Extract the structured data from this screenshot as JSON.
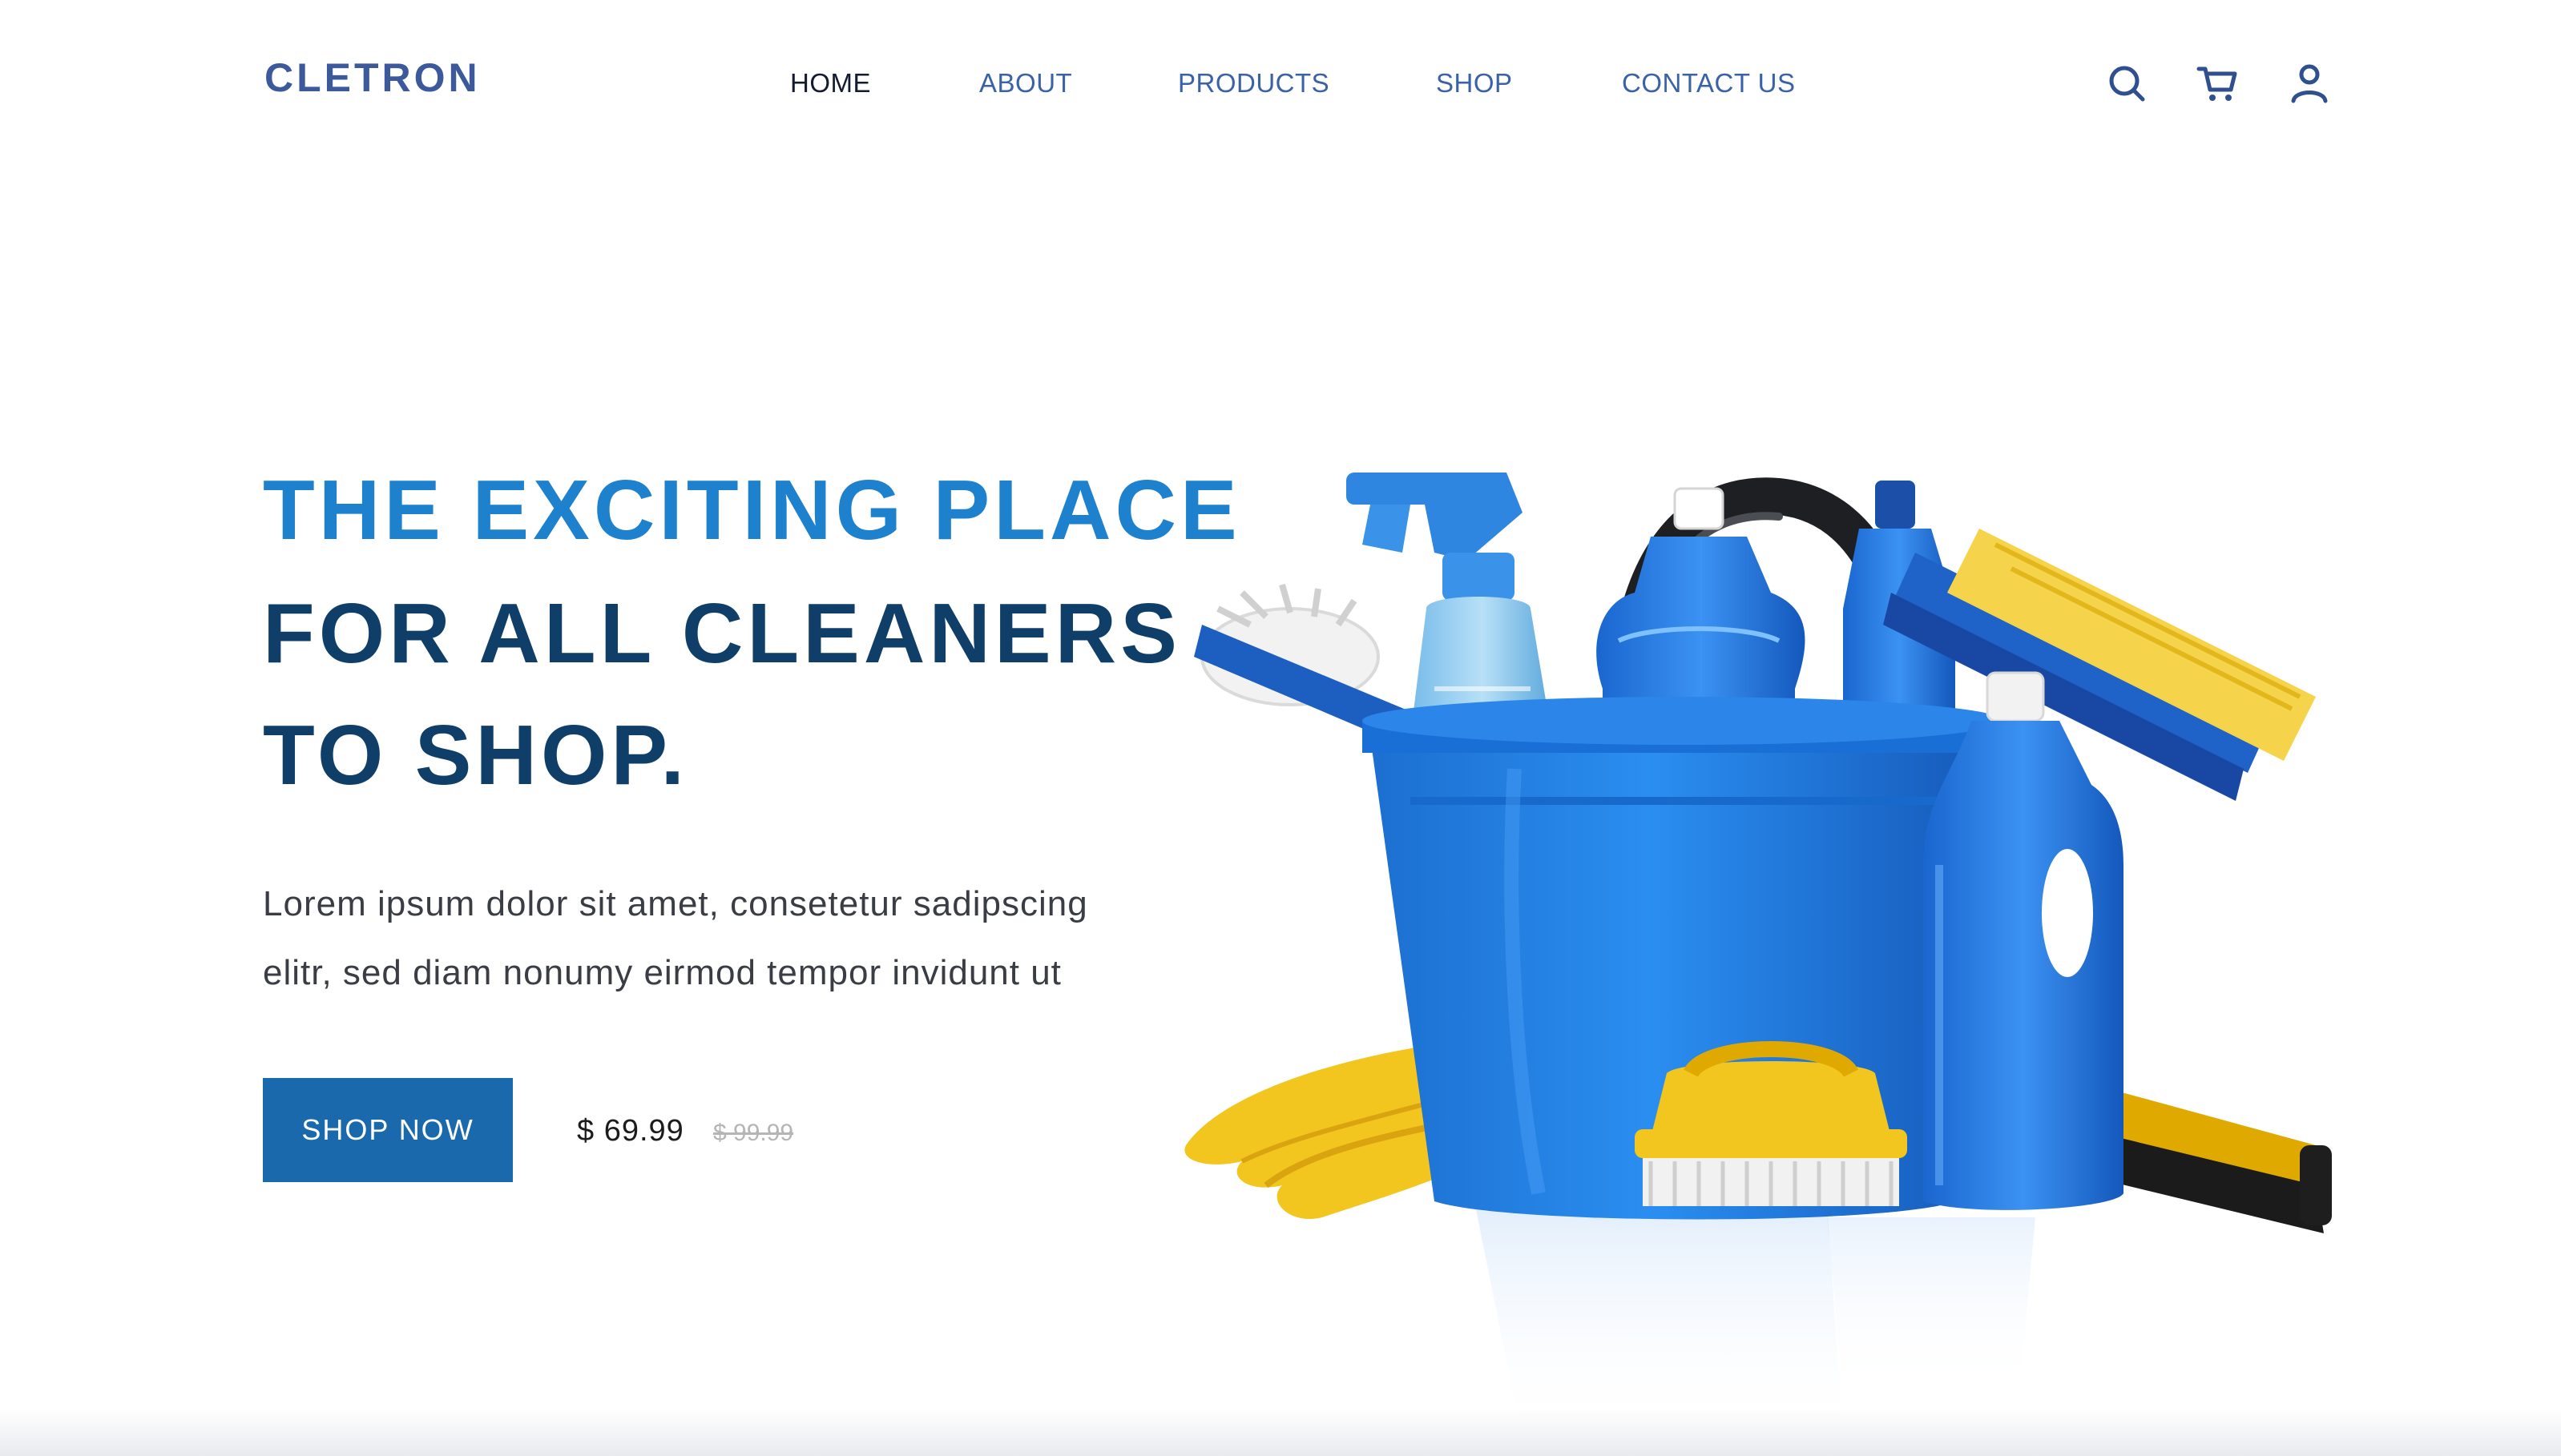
{
  "brand": {
    "name": "CLETRON",
    "color": "#3c5a9b"
  },
  "nav": {
    "items": [
      {
        "label": "HOME",
        "active": true
      },
      {
        "label": "ABOUT",
        "active": false
      },
      {
        "label": "PRODUCTS",
        "active": false
      },
      {
        "label": "SHOP",
        "active": false
      },
      {
        "label": "CONTACT US",
        "active": false
      }
    ]
  },
  "header_icons": [
    "search-icon",
    "cart-icon",
    "user-icon"
  ],
  "hero": {
    "headline_line1": "THE EXCITING PLACE",
    "headline_line2": "FOR ALL CLEANERS",
    "headline_line3": "TO SHOP.",
    "description_line1": "Lorem ipsum dolor sit amet, consetetur sadipscing",
    "description_line2": "elitr, sed diam nonumy eirmod tempor invidunt ut",
    "cta_label": "SHOP NOW",
    "price": "$ 69.99",
    "old_price": "$ 99.99",
    "image_subject": "blue bucket with cleaning supplies, yellow gloves, brush and squeegee"
  },
  "colors": {
    "accent_blue": "#1e81ce",
    "dark_navy": "#0f3f68",
    "button_blue": "#1a69ad",
    "nav_text": "#3a62a7",
    "gloves_yellow": "#f3c51f"
  }
}
